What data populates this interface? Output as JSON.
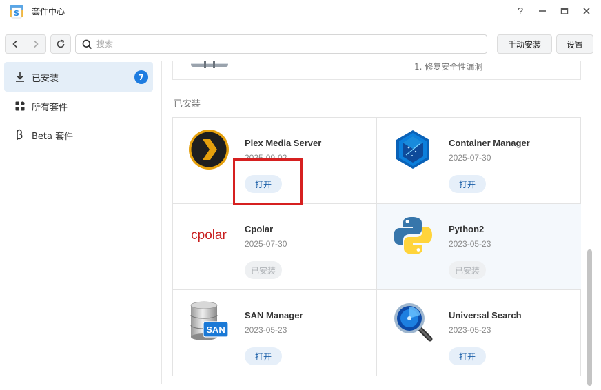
{
  "window": {
    "title": "套件中心"
  },
  "toolbar": {
    "search_placeholder": "搜索",
    "manual_install_label": "手动安装",
    "settings_label": "设置"
  },
  "sidebar": {
    "items": [
      {
        "label": "已安装",
        "badge": "7",
        "icon": "download-icon",
        "active": true
      },
      {
        "label": "所有套件",
        "icon": "grid-icon",
        "active": false
      },
      {
        "label": "Beta 套件",
        "icon": "beta-icon",
        "active": false
      }
    ]
  },
  "main": {
    "top_card_note": "1. 修复安全性漏洞",
    "section_title": "已安装",
    "packages": [
      {
        "name": "Plex Media Server",
        "date": "2025-09-02",
        "action": "打开",
        "state": "open"
      },
      {
        "name": "Container Manager",
        "date": "2025-07-30",
        "action": "打开",
        "state": "open"
      },
      {
        "name": "Cpolar",
        "logo_text": "cpolar",
        "date": "2025-07-30",
        "action": "已安装",
        "state": "installed"
      },
      {
        "name": "Python2",
        "date": "2023-05-23",
        "action": "已安装",
        "state": "installed"
      },
      {
        "name": "SAN Manager",
        "logo_text": "SAN",
        "date": "2023-05-23",
        "action": "打开",
        "state": "open"
      },
      {
        "name": "Universal Search",
        "date": "2023-05-23",
        "action": "打开",
        "state": "open"
      }
    ]
  },
  "colors": {
    "accent": "#1e7ce0",
    "highlight_box": "#d62020",
    "plex_yellow": "#e5a00d",
    "cpolar_red": "#c81e1e"
  }
}
